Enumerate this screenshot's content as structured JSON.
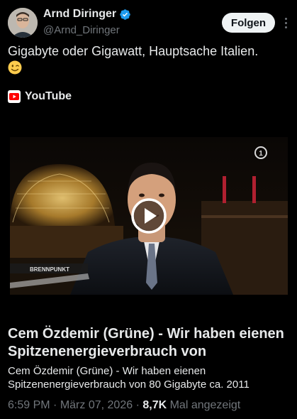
{
  "author": {
    "name": "Arnd Diringer",
    "handle": "@Arnd_Diringer",
    "verified": true
  },
  "follow_label": "Folgen",
  "tweet": {
    "text": "Gigabyte oder Gigawatt, Hauptsache Italien.",
    "emoji": "winking-face"
  },
  "source": {
    "label": "YouTube",
    "icon": "youtube-icon"
  },
  "video": {
    "overlay_text": "BRENNPUNKT",
    "play_icon": "play-icon"
  },
  "card": {
    "title": "Cem Özdemir (Grüne) - Wir haben eienen Spitzenenergieverbrauch von",
    "description": "Cem Özdemir (Grüne) - Wir haben eienen Spitzenenergieverbrauch von 80 Gigabyte ca. 2011"
  },
  "meta": {
    "time": "6:59 PM",
    "separator": "·",
    "date": "März 07, 2026",
    "views": "8,7K",
    "views_label": "Mal angezeigt"
  },
  "colors": {
    "background": "#000000",
    "text": "#e7e9ea",
    "secondary": "#71767b",
    "verified": "#1d9bf0",
    "youtube": "#ff0000"
  }
}
